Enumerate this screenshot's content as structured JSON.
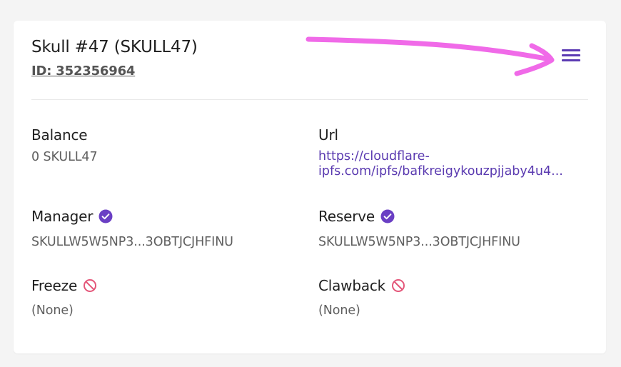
{
  "asset": {
    "title": "Skull #47 (SKULL47)",
    "id_label": "ID: 352356964"
  },
  "menu": {
    "icon": "hamburger-menu-icon"
  },
  "fields": {
    "balance": {
      "label": "Balance",
      "value": "0 SKULL47"
    },
    "url": {
      "label": "Url",
      "line1": "https://cloudflare-",
      "line2": "ipfs.com/ipfs/bafkreigykouzpjjaby4u4..."
    },
    "manager": {
      "label": "Manager",
      "value": "SKULLW5W5NP3...3OBTJCJHFINU",
      "icon": "verified-check-icon"
    },
    "reserve": {
      "label": "Reserve",
      "value": "SKULLW5W5NP3...3OBTJCJHFINU",
      "icon": "verified-check-icon"
    },
    "freeze": {
      "label": "Freeze",
      "value": "(None)",
      "icon": "prohibited-icon"
    },
    "clawback": {
      "label": "Clawback",
      "value": "(None)",
      "icon": "prohibited-icon"
    }
  },
  "colors": {
    "accent": "#5b3ab3",
    "verified": "#6a3fc4",
    "prohibited": "#e4577a",
    "annotation_arrow": "#f06ae8"
  }
}
